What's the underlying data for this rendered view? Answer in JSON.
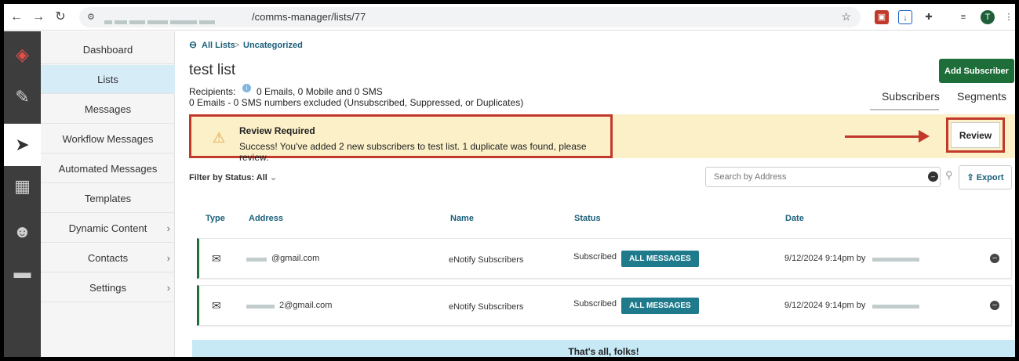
{
  "browser": {
    "url_tail": "/comms-manager/lists/77",
    "back": "←",
    "forward": "→",
    "reload": "↻",
    "avatar": "T"
  },
  "rail": {
    "icons": [
      "logo-icon",
      "feather-icon",
      "paper-plane-icon",
      "dashboard-grid-icon",
      "people-icon",
      "folder-icon"
    ]
  },
  "sidebar": {
    "items": [
      {
        "label": "Dashboard",
        "has_chevron": false
      },
      {
        "label": "Lists",
        "has_chevron": false,
        "active": true
      },
      {
        "label": "Messages",
        "has_chevron": false
      },
      {
        "label": "Workflow Messages",
        "has_chevron": false
      },
      {
        "label": "Automated Messages",
        "has_chevron": false
      },
      {
        "label": "Templates",
        "has_chevron": false
      },
      {
        "label": "Dynamic Content",
        "has_chevron": true
      },
      {
        "label": "Contacts",
        "has_chevron": true
      },
      {
        "label": "Settings",
        "has_chevron": true
      }
    ],
    "chevron": "›"
  },
  "breadcrumb": {
    "back": "All Lists",
    "sep": ">",
    "current": "Uncategorized"
  },
  "page": {
    "title": "test list",
    "recipients_label": "Recipients:",
    "recipients_value": "0 Emails, 0 Mobile and 0 SMS",
    "excluded": "0 Emails - 0 SMS numbers excluded (Unsubscribed, Suppressed, or Duplicates)",
    "add_subscriber": "Add Subscriber"
  },
  "tabs": {
    "subscribers": "Subscribers",
    "segments": "Segments"
  },
  "alert": {
    "title": "Review Required",
    "message": "Success! You've added 2 new subscribers to test list. 1 duplicate was found, please review.",
    "review_button": "Review"
  },
  "filter": {
    "label": "Filter by Status: All",
    "chevron": "⌄"
  },
  "search": {
    "placeholder": "Search by Address"
  },
  "export": "Export",
  "table": {
    "headers": {
      "type": "Type",
      "address": "Address",
      "name": "Name",
      "status": "Status",
      "date": "Date"
    },
    "rows": [
      {
        "address": "@gmail.com",
        "name": "eNotify Subscribers",
        "status": "Subscribed",
        "badge": "ALL MESSAGES",
        "date": "9/12/2024 9:14pm by"
      },
      {
        "address": "2@gmail.com",
        "name": "eNotify Subscribers",
        "status": "Subscribed",
        "badge": "ALL MESSAGES",
        "date": "9/12/2024 9:14pm by"
      }
    ]
  },
  "footer": "That's all, folks!",
  "colors": {
    "accent_green": "#1e6e3a",
    "link_blue": "#1a5f7a",
    "highlight_red": "#c0392b",
    "banner": "#fbf0c8"
  }
}
